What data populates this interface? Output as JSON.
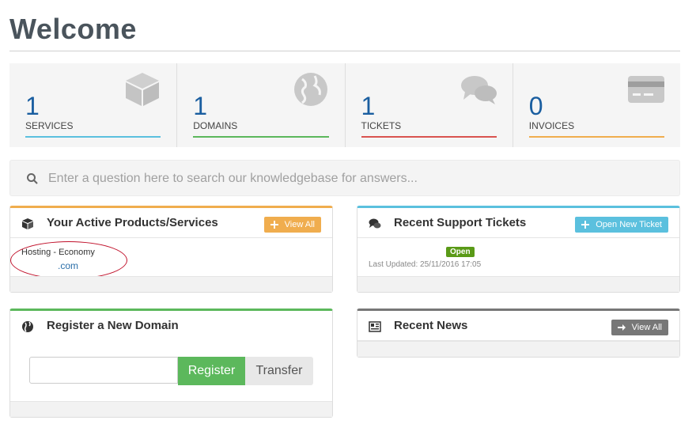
{
  "page": {
    "title": "Welcome"
  },
  "tiles": [
    {
      "stat": "1",
      "title": "SERVICES",
      "icon": "cube-icon",
      "color": "#5bc0de"
    },
    {
      "stat": "1",
      "title": "DOMAINS",
      "icon": "globe-icon",
      "color": "#5cb85c"
    },
    {
      "stat": "1",
      "title": "TICKETS",
      "icon": "comments-icon",
      "color": "#d9534f"
    },
    {
      "stat": "0",
      "title": "INVOICES",
      "icon": "credit-card-icon",
      "color": "#f0ad4e"
    }
  ],
  "search": {
    "placeholder": "Enter a question here to search our knowledgebase for answers..."
  },
  "panels": {
    "services": {
      "title": "Your Active Products/Services",
      "button": "View All",
      "accent": "#f0ad4e",
      "item": {
        "name": "Hosting - Economy",
        "domain": ".com"
      }
    },
    "tickets": {
      "title": "Recent Support Tickets",
      "button": "Open New Ticket",
      "accent": "#5bc0de",
      "item": {
        "status": "Open",
        "updated": "Last Updated: 25/11/2016 17:05"
      }
    },
    "domain": {
      "title": "Register a New Domain",
      "accent": "#5cb85c",
      "register": "Register",
      "transfer": "Transfer"
    },
    "news": {
      "title": "Recent News",
      "button": "View All",
      "accent": "#777777"
    }
  }
}
